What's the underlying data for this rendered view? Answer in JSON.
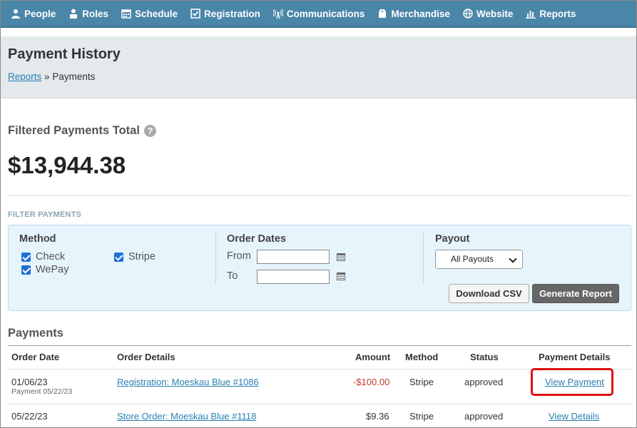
{
  "nav": {
    "items": [
      {
        "label": "People",
        "icon": "people-icon"
      },
      {
        "label": "Roles",
        "icon": "roles-icon"
      },
      {
        "label": "Schedule",
        "icon": "calendar-icon"
      },
      {
        "label": "Registration",
        "icon": "checkbox-icon"
      },
      {
        "label": "Communications",
        "icon": "broadcast-icon"
      },
      {
        "label": "Merchandise",
        "icon": "tag-icon"
      },
      {
        "label": "Website",
        "icon": "globe-icon"
      },
      {
        "label": "Reports",
        "icon": "bar-chart-icon"
      }
    ]
  },
  "header": {
    "title": "Payment History",
    "breadcrumb_link": "Reports",
    "breadcrumb_sep": "»",
    "breadcrumb_current": "Payments"
  },
  "summary": {
    "label": "Filtered Payments Total",
    "help_glyph": "?",
    "value": "$13,944.38"
  },
  "filter": {
    "heading": "FILTER PAYMENTS",
    "method": {
      "title": "Method",
      "options": [
        {
          "label": "Check",
          "checked": true
        },
        {
          "label": "Stripe",
          "checked": true
        },
        {
          "label": "WePay",
          "checked": true
        }
      ]
    },
    "dates": {
      "title": "Order Dates",
      "from_label": "From",
      "to_label": "To",
      "from_value": "",
      "to_value": ""
    },
    "payout": {
      "title": "Payout",
      "selected": "All Payouts"
    },
    "download_label": "Download CSV",
    "generate_label": "Generate Report"
  },
  "payments": {
    "title": "Payments",
    "columns": [
      "Order Date",
      "Order Details",
      "Amount",
      "Method",
      "Status",
      "Payment Details"
    ],
    "rows": [
      {
        "date": "01/06/23",
        "sub": "Payment 05/22/23",
        "details": "Registration: Moeskau Blue #1086",
        "amount": "-$100.00",
        "method": "Stripe",
        "status": "approved",
        "action": "View Payment"
      },
      {
        "date": "05/22/23",
        "sub": "",
        "details": "Store Order: Moeskau Blue #1118",
        "amount": "$9.36",
        "method": "Stripe",
        "status": "approved",
        "action": "View Details"
      }
    ]
  },
  "colors": {
    "nav_bg": "#4a86a8",
    "link": "#2a7fb0",
    "negative": "#c0392b",
    "highlight": "#e01010"
  }
}
